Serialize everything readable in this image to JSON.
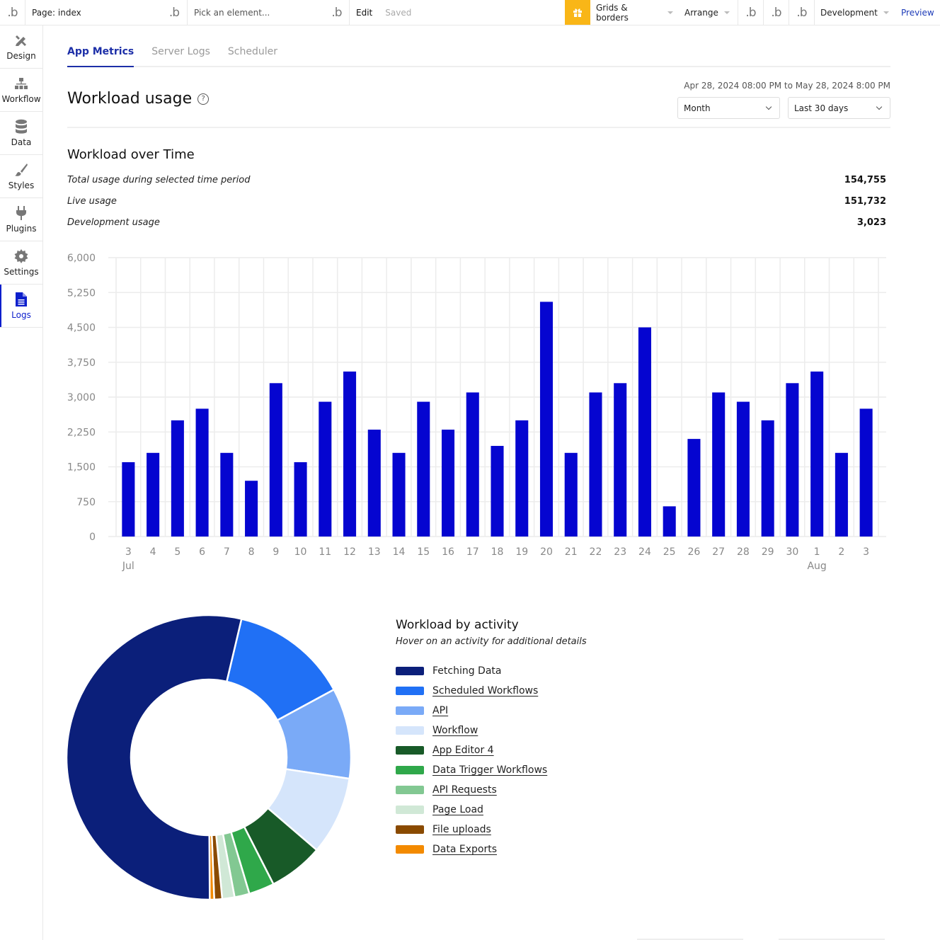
{
  "topbar": {
    "logo": ".b",
    "page_label": "Page: index",
    "pick_placeholder": "Pick an element...",
    "edit_label": "Edit",
    "saved_label": "Saved",
    "gift_icon": "gift-icon",
    "grids_label": "Grids & borders",
    "arrange_label": "Arrange",
    "env_label": "Development",
    "preview_label": "Preview",
    "accent": "#f9b617"
  },
  "sidebar": {
    "items": [
      {
        "label": "Design",
        "icon": "design-icon"
      },
      {
        "label": "Workflow",
        "icon": "workflow-icon"
      },
      {
        "label": "Data",
        "icon": "database-icon"
      },
      {
        "label": "Styles",
        "icon": "brush-icon"
      },
      {
        "label": "Plugins",
        "icon": "plug-icon"
      },
      {
        "label": "Settings",
        "icon": "gear-icon"
      },
      {
        "label": "Logs",
        "icon": "document-icon",
        "active": true
      }
    ]
  },
  "tabs": [
    {
      "label": "App Metrics",
      "active": true
    },
    {
      "label": "Server Logs"
    },
    {
      "label": "Scheduler"
    }
  ],
  "header": {
    "title": "Workload usage",
    "date_range": "Apr 28, 2024 08:00 PM to May 28, 2024 8:00 PM",
    "granularity": "Month",
    "period": "Last 30 days"
  },
  "workload_over_time": {
    "title": "Workload over Time",
    "stats": [
      {
        "label": "Total usage during selected time period",
        "value": "154,755"
      },
      {
        "label": "Live usage",
        "value": "151,732"
      },
      {
        "label": "Development usage",
        "value": "3,023"
      }
    ]
  },
  "chart_data": [
    {
      "type": "bar",
      "title": "Workload over Time",
      "categories": [
        "3",
        "4",
        "5",
        "6",
        "7",
        "8",
        "9",
        "10",
        "11",
        "12",
        "13",
        "14",
        "15",
        "16",
        "17",
        "18",
        "19",
        "20",
        "21",
        "22",
        "23",
        "24",
        "25",
        "26",
        "27",
        "28",
        "29",
        "30",
        "1",
        "2",
        "3"
      ],
      "month_labels": [
        {
          "index": 0,
          "label": "Jul"
        },
        {
          "index": 28,
          "label": "Aug"
        }
      ],
      "values": [
        1600,
        1800,
        2500,
        2750,
        1800,
        1200,
        3300,
        1600,
        2900,
        3550,
        2300,
        1800,
        2900,
        2300,
        3100,
        1950,
        2500,
        5050,
        1800,
        3100,
        3300,
        4500,
        650,
        2100,
        3100,
        2900,
        2500,
        3300,
        3550,
        1800,
        2750
      ],
      "ylim": [
        0,
        6000
      ],
      "yticks": [
        "0",
        "750",
        "1,500",
        "2,250",
        "3,000",
        "3,750",
        "4,500",
        "5,250",
        "6,000"
      ],
      "ytick_values": [
        0,
        750,
        1500,
        2250,
        3000,
        3750,
        4500,
        5250,
        6000
      ],
      "grid": true,
      "color": "#0505d0",
      "xlabel": "",
      "ylabel": ""
    },
    {
      "type": "pie",
      "title": "Workload by activity",
      "subtitle": "Hover on an activity for additional details",
      "donut": true,
      "slices": [
        {
          "label": "Fetching Data",
          "value": 53.8,
          "color": "#0b1f7a",
          "underlined": false
        },
        {
          "label": "Scheduled Workflows",
          "value": 13.4,
          "color": "#2070f5",
          "underlined": true
        },
        {
          "label": "API",
          "value": 10.3,
          "color": "#7aaaf7",
          "underlined": true
        },
        {
          "label": "Workflow",
          "value": 8.9,
          "color": "#d5e5fb",
          "underlined": true
        },
        {
          "label": "App Editor 4",
          "value": 6.2,
          "color": "#185a28",
          "underlined": true
        },
        {
          "label": "Data Trigger Workflows",
          "value": 2.9,
          "color": "#2fa84a",
          "underlined": true
        },
        {
          "label": "API Requests",
          "value": 1.7,
          "color": "#82c892",
          "underlined": true
        },
        {
          "label": "Page Load",
          "value": 1.4,
          "color": "#d0e8d6",
          "underlined": true
        },
        {
          "label": "File uploads",
          "value": 0.9,
          "color": "#8a4a00",
          "underlined": true
        },
        {
          "label": "Data Exports",
          "value": 0.5,
          "color": "#f38a00",
          "underlined": true
        }
      ],
      "start_slice_index": 1,
      "start_angle_deg": 13.3,
      "legend": "right"
    }
  ]
}
